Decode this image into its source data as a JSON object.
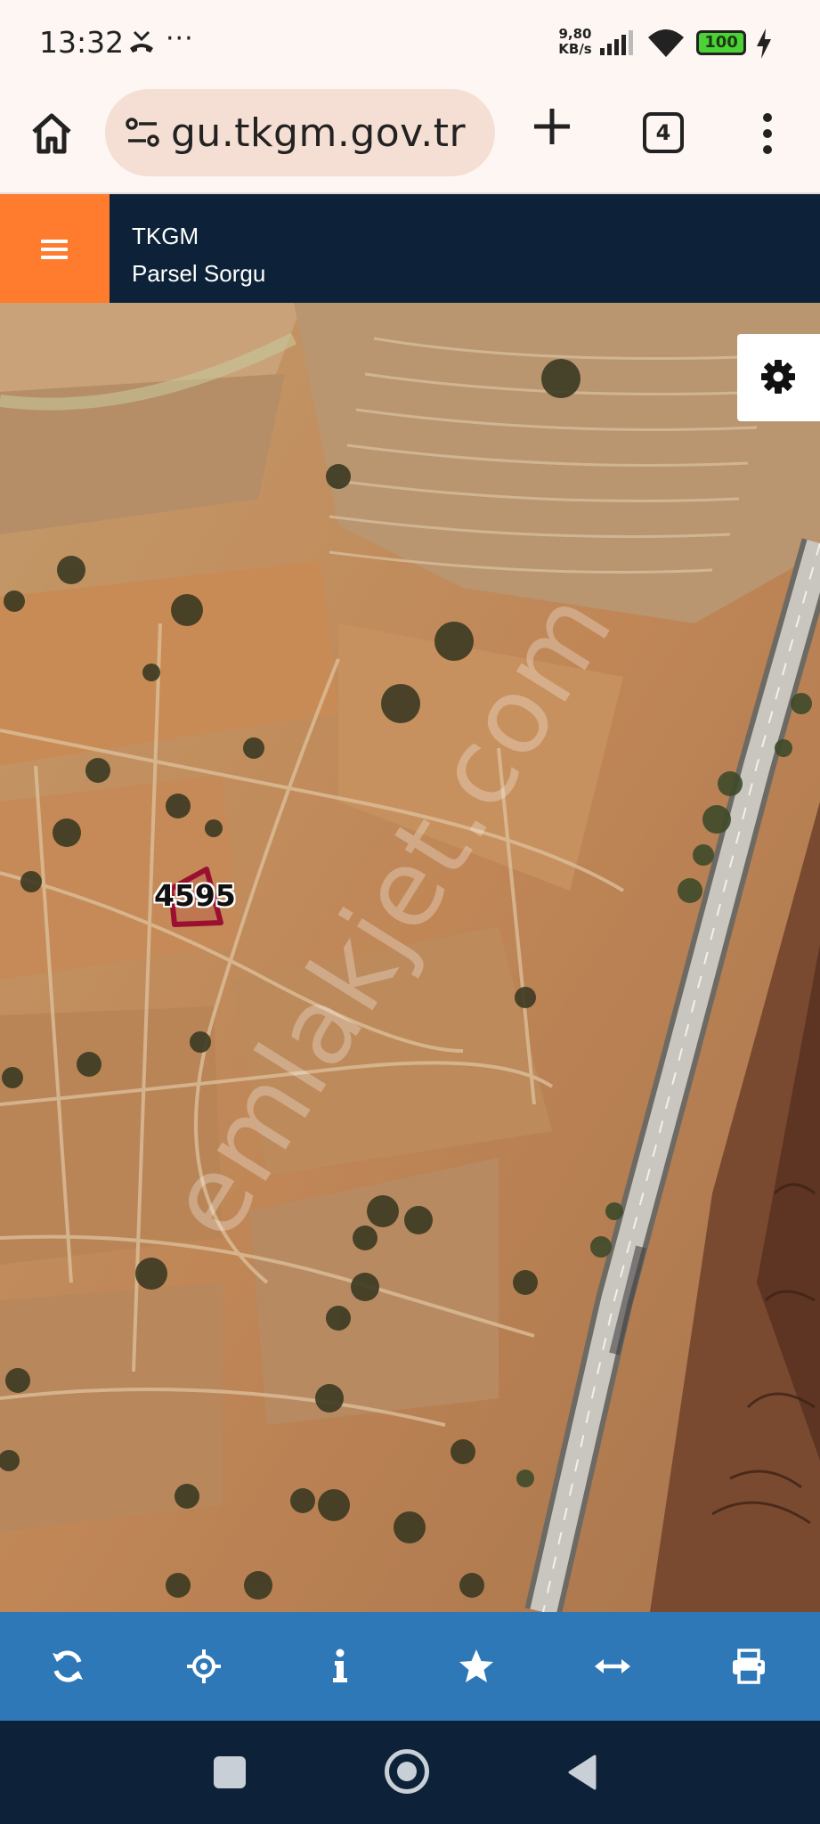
{
  "status_bar": {
    "time": "13:32",
    "dots": "···",
    "speed_value": "9,80",
    "speed_unit": "KB/s",
    "battery": "100",
    "icons": [
      "missed-call-icon",
      "signal-icon",
      "wifi-icon",
      "battery-icon",
      "charging-icon"
    ]
  },
  "browser": {
    "url": "gu.tkgm.gov.tr",
    "tab_count": "4",
    "icons": [
      "home-icon",
      "site-info-icon",
      "plus-icon",
      "more-vert-icon"
    ]
  },
  "app": {
    "title": "TKGM",
    "subtitle": "Parsel Sorgu",
    "menu_color": "#ff7b2d",
    "header_color": "#0d2238"
  },
  "map": {
    "parcel_number": "4595",
    "watermark": "emlakjet.com",
    "settings_icon": "gear-icon",
    "parcel_outline_color": "#9b1030"
  },
  "toolbar": {
    "color": "#2f78b8",
    "tools": [
      "refresh-icon",
      "locate-icon",
      "info-icon",
      "star-icon",
      "measure-icon",
      "print-icon"
    ]
  },
  "nav_bar": {
    "buttons": [
      "recents-button",
      "home-button",
      "back-button"
    ]
  }
}
